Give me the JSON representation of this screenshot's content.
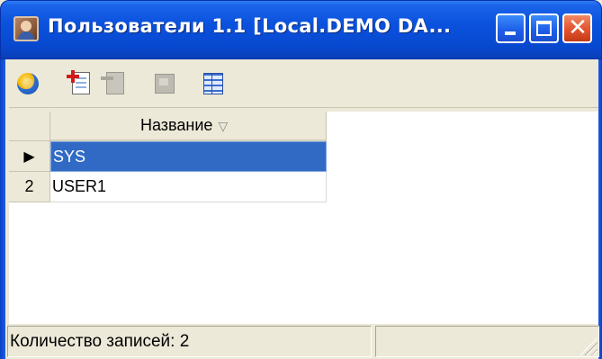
{
  "window": {
    "title": "Пользователи 1.1 [Local.DEMO DA...",
    "icon": "user-portrait-icon",
    "controls": {
      "minimize": "minimize-icon",
      "maximize": "maximize-icon",
      "close": "close-icon",
      "close_glyph": "✕"
    },
    "colors": {
      "titlebar": "#0a52dd",
      "close_button": "#e2522d",
      "selection": "#316ac5"
    }
  },
  "toolbar": {
    "buttons": [
      {
        "name": "refresh",
        "icon": "refresh-icon",
        "enabled": true
      },
      {
        "name": "add",
        "icon": "add-record-icon",
        "enabled": true
      },
      {
        "name": "delete",
        "icon": "delete-record-icon",
        "enabled": false
      },
      {
        "name": "edit",
        "icon": "edit-record-icon",
        "enabled": false
      },
      {
        "name": "grid",
        "icon": "grid-view-icon",
        "enabled": true
      }
    ]
  },
  "grid": {
    "columns": [
      {
        "label": "Название",
        "sort_icon": "▽"
      }
    ],
    "rows": [
      {
        "indicator": "▶",
        "name": "SYS",
        "selected": true
      },
      {
        "indicator": "2",
        "name": "USER1",
        "selected": false
      }
    ]
  },
  "statusbar": {
    "record_count": "Количество записей: 2",
    "right_text": ""
  }
}
